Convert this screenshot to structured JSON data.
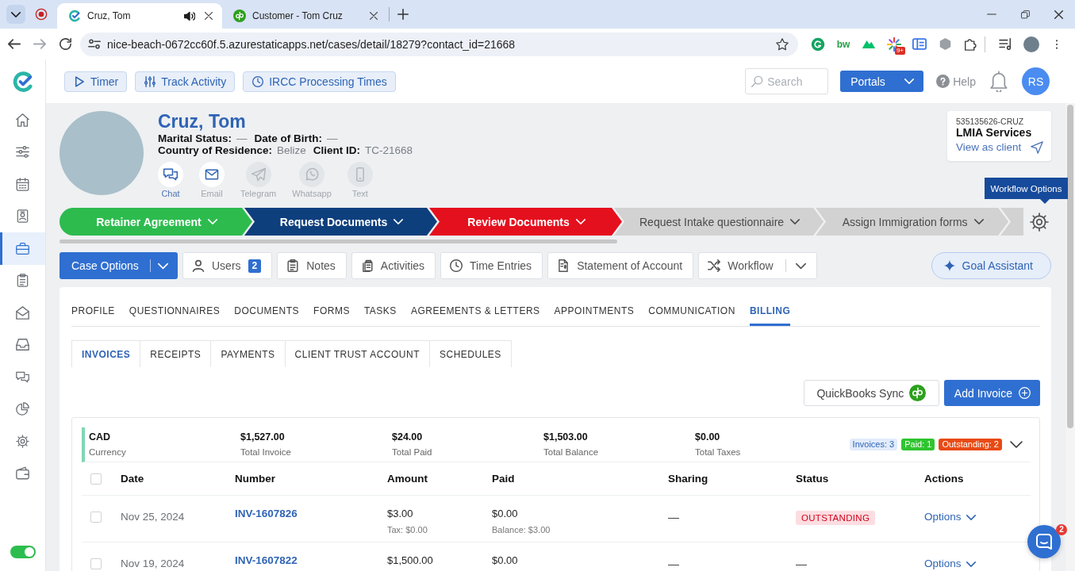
{
  "browser": {
    "tabs": [
      {
        "title": "Cruz, Tom",
        "selected": true,
        "audio": true
      },
      {
        "title": "Customer - Tom Cruz",
        "selected": false,
        "audio": false
      }
    ],
    "url": "nice-beach-0672cc60f.5.azurestaticapps.net/cases/detail/18279?contact_id=21668",
    "extension_label": "bw",
    "extension_badge": "9+"
  },
  "sidebar": {
    "items": [
      {
        "selected": false
      },
      {
        "selected": false
      },
      {
        "selected": false
      },
      {
        "selected": false
      },
      {
        "selected": true
      },
      {
        "selected": false
      },
      {
        "selected": false
      },
      {
        "selected": false
      },
      {
        "selected": false
      },
      {
        "selected": false
      },
      {
        "selected": false
      },
      {
        "selected": false
      }
    ],
    "toggle": {
      "on": true
    }
  },
  "topbar": {
    "buttons": [
      {
        "label": "Timer"
      },
      {
        "label": "Track Activity"
      },
      {
        "label": "IRCC Processing Times"
      }
    ],
    "search": {
      "placeholder": "Search"
    },
    "portals": "Portals",
    "help": "Help",
    "user_initials": "RS"
  },
  "client": {
    "name": "Cruz, Tom",
    "detail_lines": [
      [
        {
          "label": "Marital Status:",
          "value": "—"
        },
        {
          "label": "Date of Birth:",
          "value": "—"
        }
      ],
      [
        {
          "label": "Country of Residence:",
          "value": "Belize"
        },
        {
          "label": "Client ID:",
          "value": "TC-21668"
        }
      ]
    ],
    "contacts": [
      {
        "label": "Chat",
        "disabled": false,
        "selected": true
      },
      {
        "label": "Email",
        "disabled": false,
        "selected": false
      },
      {
        "label": "Telegram",
        "disabled": true,
        "selected": false
      },
      {
        "label": "Whatsapp",
        "disabled": true,
        "selected": false
      },
      {
        "label": "Text",
        "disabled": true,
        "selected": false
      }
    ]
  },
  "case_card": {
    "case_number": "535135626-CRUZ",
    "service": "LMIA Services",
    "link": "View as client"
  },
  "tooltip": {
    "text": "Workflow Options"
  },
  "workflow": {
    "steps": [
      {
        "label": "Retainer Agreement",
        "color": "#2dbb4e"
      },
      {
        "label": "Request Documents",
        "color": "#0e3f7d"
      },
      {
        "label": "Review Documents",
        "color": "#e5101e"
      },
      {
        "label": "Request Intake questionnaire",
        "color": "#d2d2d2"
      },
      {
        "label": "Assign Immigration forms",
        "color": "#d2d2d2"
      },
      {
        "color": "#d2d2d2"
      }
    ]
  },
  "case_actions": {
    "primary": "Case Options",
    "buttons": [
      {
        "label": "Users",
        "badge": "2",
        "dropdown": false
      },
      {
        "label": "Notes",
        "dropdown": false
      },
      {
        "label": "Activities",
        "dropdown": false
      },
      {
        "label": "Time Entries",
        "dropdown": false
      },
      {
        "label": "Statement of Account",
        "dropdown": false
      },
      {
        "label": "Workflow",
        "dropdown": true
      }
    ],
    "assistant": "Goal Assistant"
  },
  "tabs": [
    {
      "label": "PROFILE",
      "selected": false
    },
    {
      "label": "QUESTIONNAIRES",
      "selected": false
    },
    {
      "label": "DOCUMENTS",
      "selected": false
    },
    {
      "label": "FORMS",
      "selected": false
    },
    {
      "label": "TASKS",
      "selected": false
    },
    {
      "label": "AGREEMENTS & LETTERS",
      "selected": false
    },
    {
      "label": "APPOINTMENTS",
      "selected": false
    },
    {
      "label": "COMMUNICATION",
      "selected": false
    },
    {
      "label": "BILLING",
      "selected": true
    }
  ],
  "subtabs": [
    {
      "label": "INVOICES",
      "selected": true
    },
    {
      "label": "RECEIPTS",
      "selected": false
    },
    {
      "label": "PAYMENTS",
      "selected": false
    },
    {
      "label": "CLIENT TRUST ACCOUNT",
      "selected": false
    },
    {
      "label": "SCHEDULES",
      "selected": false
    }
  ],
  "billing_actions": {
    "sync": "QuickBooks Sync",
    "add": "Add Invoice"
  },
  "invoices": {
    "summary": [
      {
        "value": "CAD",
        "label": "Currency"
      },
      {
        "value": "$1,527.00",
        "label": "Total Invoice"
      },
      {
        "value": "$24.00",
        "label": "Total Paid"
      },
      {
        "value": "$1,503.00",
        "label": "Total Balance"
      },
      {
        "value": "$0.00",
        "label": "Total Taxes"
      }
    ],
    "badges": [
      {
        "label": "Invoices: 3",
        "color": "#e1ecfb"
      },
      {
        "label": "Paid: 1",
        "color": "#2fc42f"
      },
      {
        "label": "Outstanding: 2",
        "color": "#e84a14"
      }
    ],
    "select_all": false,
    "columns": [
      "Date",
      "Number",
      "Amount",
      "Paid",
      "Sharing",
      "Status",
      "Actions"
    ],
    "rows": [
      {
        "checked": false,
        "date": "Nov 25, 2024",
        "number": "INV-1607826",
        "amount": "$3.00",
        "tax": "Tax: $0.00",
        "paid": "$0.00",
        "balance": "Balance: $3.00",
        "sharing": "—",
        "status": {
          "kind": "badge",
          "text": "OUTSTANDING"
        },
        "action": "Options"
      },
      {
        "checked": false,
        "date": "Nov 19, 2024",
        "number": "INV-1607822",
        "amount": "$1,500.00",
        "paid": "$0.00",
        "sharing": "—",
        "status": {
          "kind": "plain",
          "text": "—"
        },
        "action": "Options"
      }
    ]
  },
  "chat_launcher": {
    "badge": "2"
  }
}
